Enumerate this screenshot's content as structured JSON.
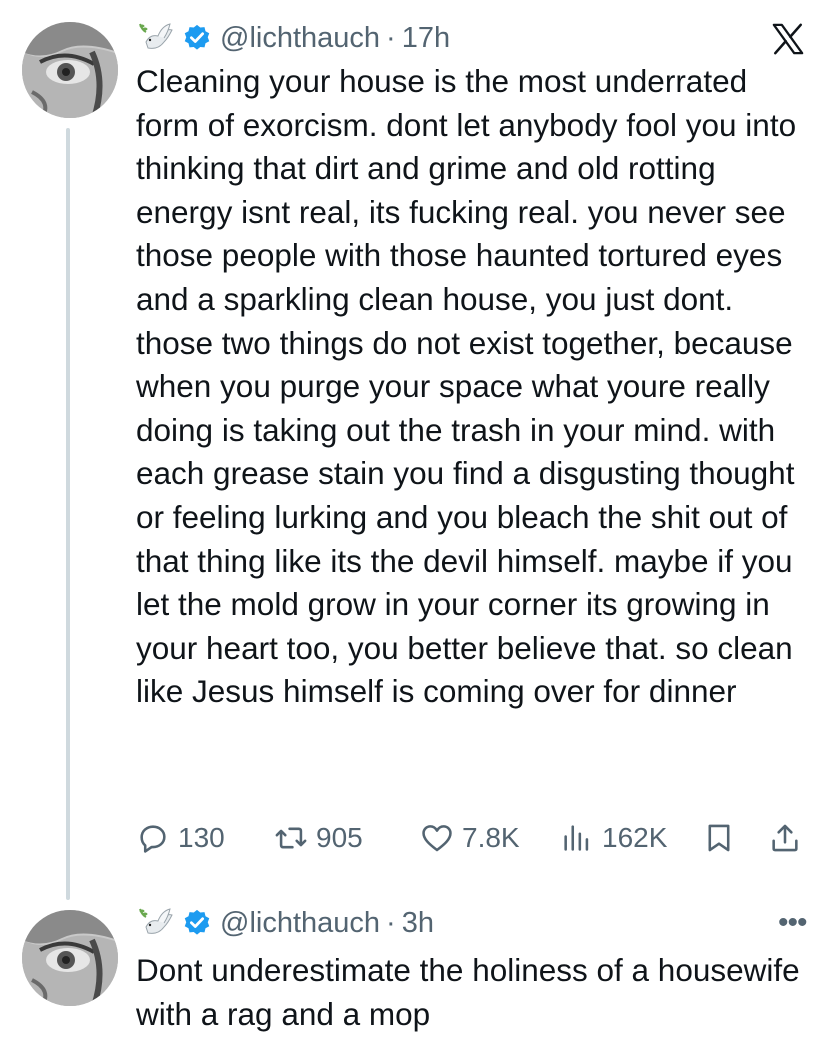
{
  "tweet1": {
    "handle": "@lichthauch",
    "separator": "·",
    "time": "17h",
    "text": "Cleaning your house is the most underrated form of exorcism. dont let anybody fool you into thinking that dirt and grime and old rotting energy isnt real, its fucking real. you never see those people with those haunted tortured eyes and a sparkling clean house, you just dont. those two things do not exist together, because when you purge your space what youre really doing is taking out the trash in your mind. with each grease stain you find a disgusting thought or feeling lurking and you bleach the shit out of that thing like its the devil himself. maybe if you let the mold grow in your corner its growing in your heart too, you better believe that. so clean like Jesus himself is coming over for dinner",
    "stats": {
      "replies": "130",
      "reposts": "905",
      "likes": "7.8K",
      "views": "162K"
    }
  },
  "tweet2": {
    "handle": "@lichthauch",
    "separator": "·",
    "time": "3h",
    "text": "Dont underestimate the holiness of a housewife with a rag and a mop"
  },
  "colors": {
    "text": "#0f1419",
    "secondary": "#536471",
    "verified": "#1d9bf0",
    "thread_line": "#cfd9de"
  }
}
